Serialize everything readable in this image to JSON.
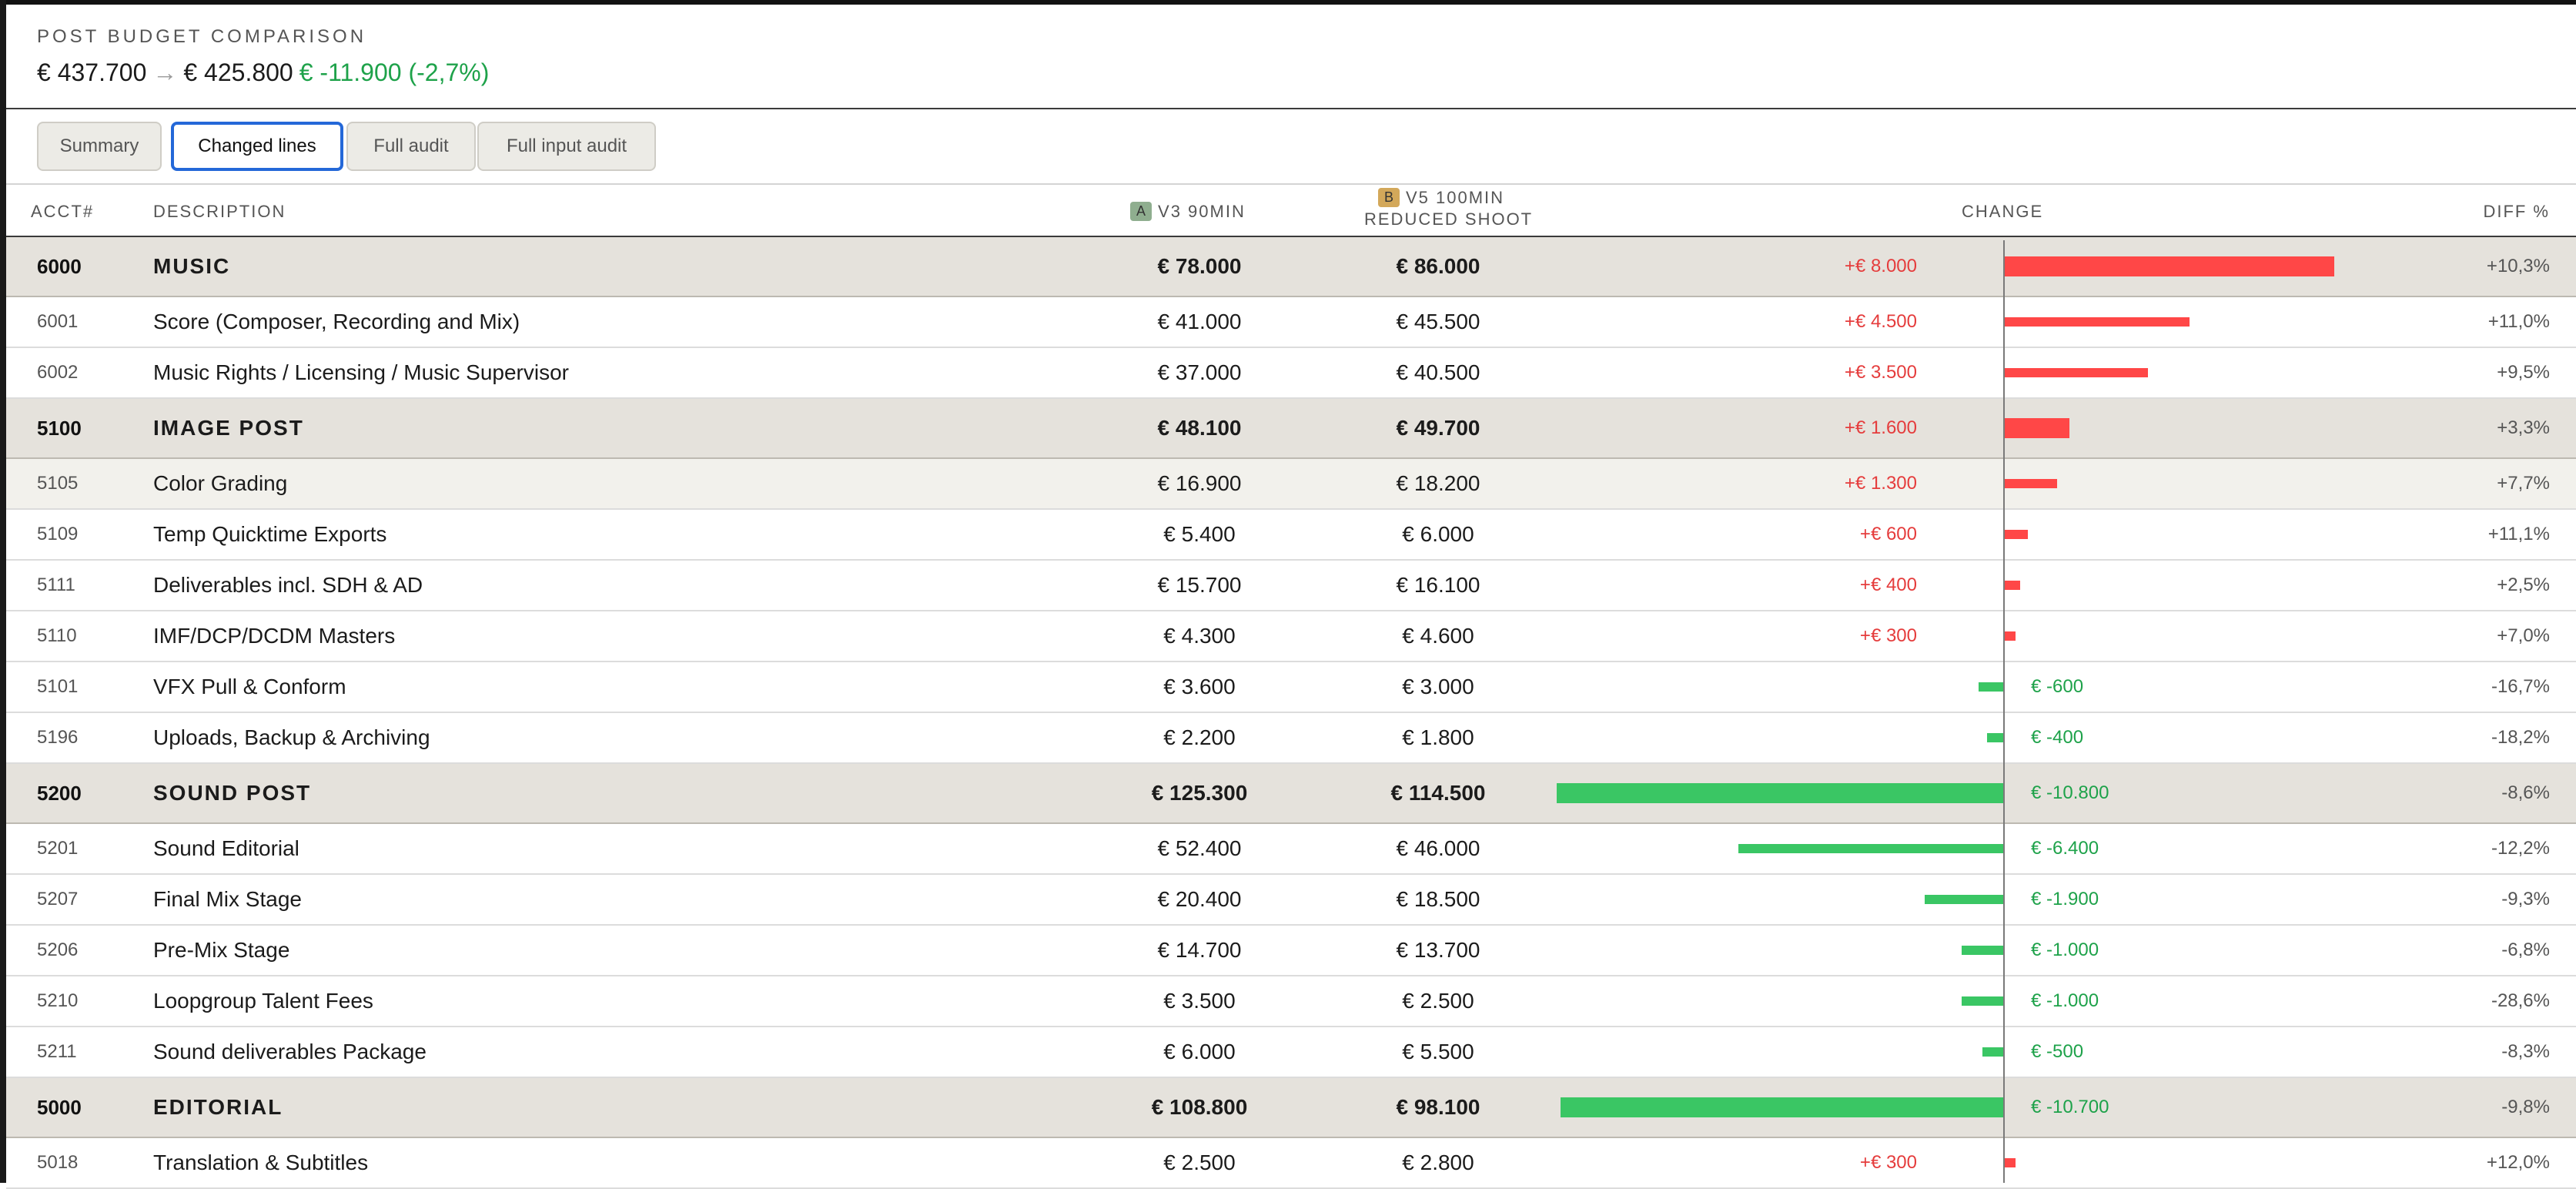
{
  "header": {
    "title": "POST BUDGET COMPARISON",
    "total_a": "€ 437.700",
    "arrow": "→",
    "total_b": "€ 425.800",
    "delta": "€ -11.900 (-2,7%)"
  },
  "tabs": [
    {
      "label": "Summary",
      "active": false
    },
    {
      "label": "Changed lines",
      "active": true
    },
    {
      "label": "Full audit",
      "active": false
    },
    {
      "label": "Full input audit",
      "active": false
    }
  ],
  "columns": {
    "acct": "ACCT#",
    "description": "DESCRIPTION",
    "a_badge": "A",
    "a_label": "V3 90MIN",
    "b_badge": "B",
    "b_label_1": "V5 100MIN",
    "b_label_2": "REDUCED SHOOT",
    "change": "CHANGE",
    "diff": "DIFF %"
  },
  "colors": {
    "increase": "#ff4747",
    "decrease": "#3ac664",
    "group_bg": "#e5e2dc",
    "accent": "#2468d8"
  },
  "rows": [
    {
      "acct": "6000",
      "desc": "MUSIC",
      "a": "€ 78.000",
      "b": "€ 86.000",
      "change": "+€ 8.000",
      "change_value": 8000,
      "diff": "+10,3%",
      "group": true
    },
    {
      "acct": "6001",
      "desc": "Score (Composer, Recording and Mix)",
      "a": "€ 41.000",
      "b": "€ 45.500",
      "change": "+€ 4.500",
      "change_value": 4500,
      "diff": "+11,0%",
      "group": false
    },
    {
      "acct": "6002",
      "desc": "Music Rights / Licensing / Music Supervisor",
      "a": "€ 37.000",
      "b": "€ 40.500",
      "change": "+€ 3.500",
      "change_value": 3500,
      "diff": "+9,5%",
      "group": false
    },
    {
      "acct": "5100",
      "desc": "IMAGE POST",
      "a": "€ 48.100",
      "b": "€ 49.700",
      "change": "+€ 1.600",
      "change_value": 1600,
      "diff": "+3,3%",
      "group": true
    },
    {
      "acct": "5105",
      "desc": "Color Grading",
      "a": "€ 16.900",
      "b": "€ 18.200",
      "change": "+€ 1.300",
      "change_value": 1300,
      "diff": "+7,7%",
      "group": false,
      "shaded": true
    },
    {
      "acct": "5109",
      "desc": "Temp Quicktime Exports",
      "a": "€ 5.400",
      "b": "€ 6.000",
      "change": "+€ 600",
      "change_value": 600,
      "diff": "+11,1%",
      "group": false
    },
    {
      "acct": "5111",
      "desc": "Deliverables incl. SDH & AD",
      "a": "€ 15.700",
      "b": "€ 16.100",
      "change": "+€ 400",
      "change_value": 400,
      "diff": "+2,5%",
      "group": false
    },
    {
      "acct": "5110",
      "desc": "IMF/DCP/DCDM Masters",
      "a": "€ 4.300",
      "b": "€ 4.600",
      "change": "+€ 300",
      "change_value": 300,
      "diff": "+7,0%",
      "group": false
    },
    {
      "acct": "5101",
      "desc": "VFX Pull & Conform",
      "a": "€ 3.600",
      "b": "€ 3.000",
      "change": "€ -600",
      "change_value": -600,
      "diff": "-16,7%",
      "group": false
    },
    {
      "acct": "5196",
      "desc": "Uploads, Backup & Archiving",
      "a": "€ 2.200",
      "b": "€ 1.800",
      "change": "€ -400",
      "change_value": -400,
      "diff": "-18,2%",
      "group": false
    },
    {
      "acct": "5200",
      "desc": "SOUND POST",
      "a": "€ 125.300",
      "b": "€ 114.500",
      "change": "€ -10.800",
      "change_value": -10800,
      "diff": "-8,6%",
      "group": true
    },
    {
      "acct": "5201",
      "desc": "Sound Editorial",
      "a": "€ 52.400",
      "b": "€ 46.000",
      "change": "€ -6.400",
      "change_value": -6400,
      "diff": "-12,2%",
      "group": false
    },
    {
      "acct": "5207",
      "desc": "Final Mix Stage",
      "a": "€ 20.400",
      "b": "€ 18.500",
      "change": "€ -1.900",
      "change_value": -1900,
      "diff": "-9,3%",
      "group": false
    },
    {
      "acct": "5206",
      "desc": "Pre-Mix Stage",
      "a": "€ 14.700",
      "b": "€ 13.700",
      "change": "€ -1.000",
      "change_value": -1000,
      "diff": "-6,8%",
      "group": false
    },
    {
      "acct": "5210",
      "desc": "Loopgroup Talent Fees",
      "a": "€ 3.500",
      "b": "€ 2.500",
      "change": "€ -1.000",
      "change_value": -1000,
      "diff": "-28,6%",
      "group": false
    },
    {
      "acct": "5211",
      "desc": "Sound deliverables Package",
      "a": "€ 6.000",
      "b": "€ 5.500",
      "change": "€ -500",
      "change_value": -500,
      "diff": "-8,3%",
      "group": false
    },
    {
      "acct": "5000",
      "desc": "EDITORIAL",
      "a": "€ 108.800",
      "b": "€ 98.100",
      "change": "€ -10.700",
      "change_value": -10700,
      "diff": "-9,8%",
      "group": true
    },
    {
      "acct": "5018",
      "desc": "Translation & Subtitles",
      "a": "€ 2.500",
      "b": "€ 2.800",
      "change": "+€ 300",
      "change_value": 300,
      "diff": "+12,0%",
      "group": false
    }
  ]
}
